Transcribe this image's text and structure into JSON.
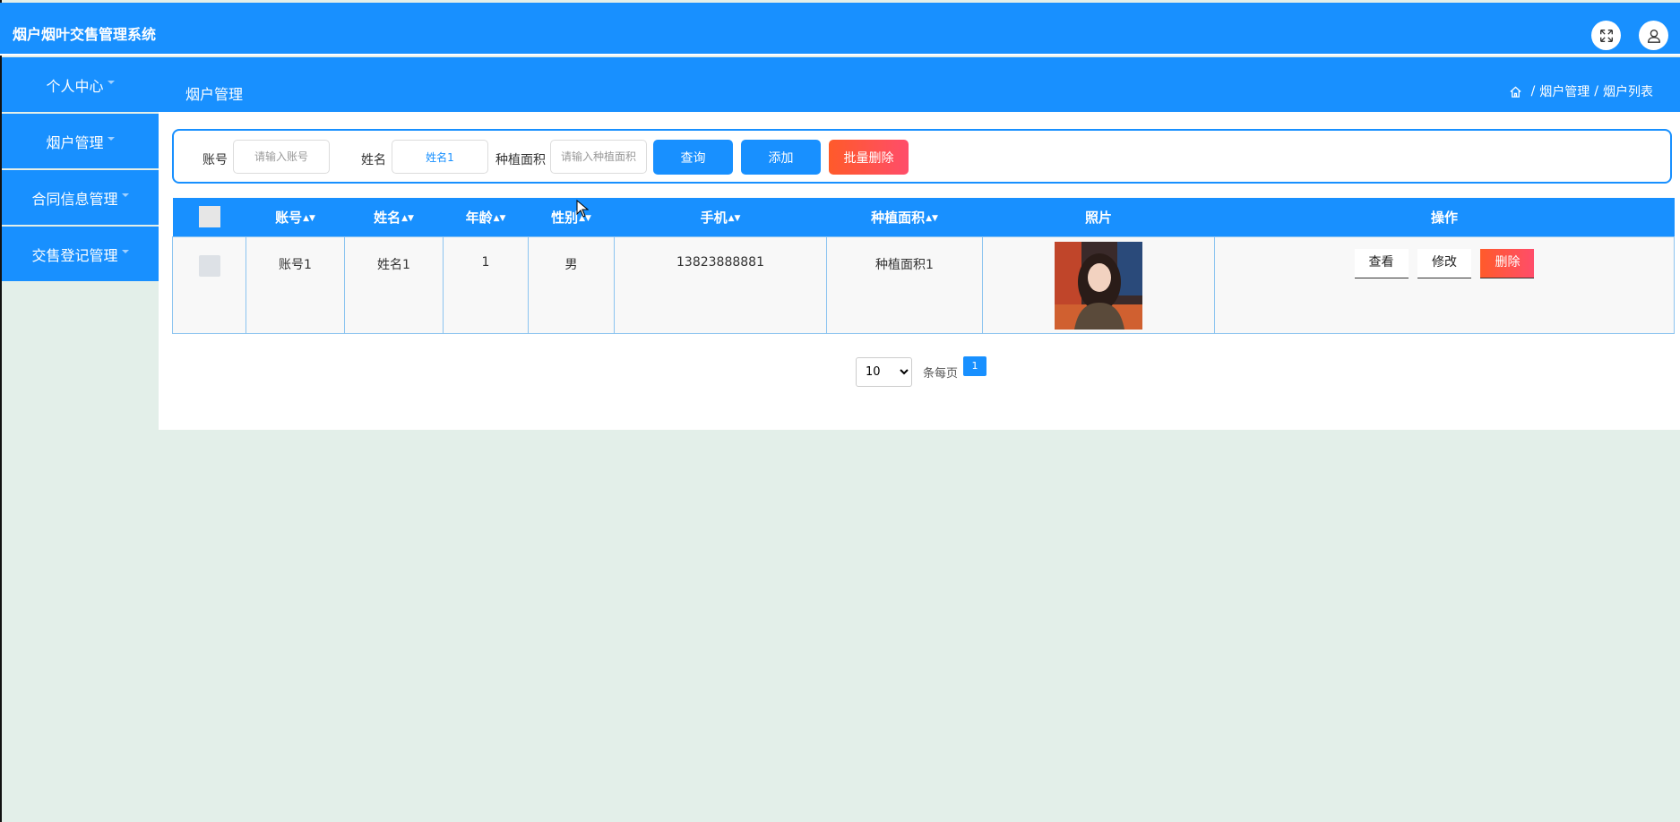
{
  "app": {
    "title": "烟户烟叶交售管理系统"
  },
  "topbar": {
    "icons": [
      "fullscreen-icon",
      "user-icon"
    ]
  },
  "sidebar": {
    "items": [
      {
        "label": "个人中心"
      },
      {
        "label": "烟户管理"
      },
      {
        "label": "合同信息管理"
      },
      {
        "label": "交售登记管理"
      }
    ]
  },
  "header": {
    "page_title": "烟户管理",
    "breadcrumb": [
      "烟户管理",
      "烟户列表"
    ]
  },
  "search": {
    "account_label": "账号",
    "account_placeholder": "请输入账号",
    "name_label": "姓名",
    "name_value": "姓名1",
    "area_label": "种植面积",
    "area_placeholder": "请输入种植面积",
    "query_label": "查询",
    "add_label": "添加",
    "batch_delete_label": "批量删除"
  },
  "table": {
    "columns": [
      "账号",
      "姓名",
      "年龄",
      "性别",
      "手机",
      "种植面积",
      "照片",
      "操作"
    ],
    "rows": [
      {
        "account": "账号1",
        "name": "姓名1",
        "age": "1",
        "gender": "男",
        "phone": "13823888881",
        "area": "种植面积1",
        "actions": [
          "查看",
          "修改",
          "删除"
        ]
      }
    ]
  },
  "pagination": {
    "page_size": "10",
    "per_page_label": "条每页",
    "current_page": "1"
  },
  "colors": {
    "primary": "#1890ff",
    "danger": "#ff4d4f",
    "background": "#e3efe9"
  }
}
